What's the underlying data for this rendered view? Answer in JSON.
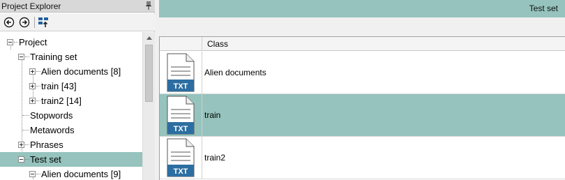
{
  "explorer": {
    "title": "Project Explorer",
    "toolbar": {
      "back_icon": "back-arrow-circle-icon",
      "forward_icon": "forward-arrow-circle-icon",
      "tool_icon": "tree-upload-icon"
    },
    "tree": [
      {
        "label": "Project",
        "expanded": true,
        "level": 0
      },
      {
        "label": "Training set",
        "expanded": true,
        "level": 1
      },
      {
        "label": "Alien documents [8]",
        "expanded": false,
        "level": 2
      },
      {
        "label": "train [43]",
        "expanded": false,
        "level": 2
      },
      {
        "label": "train2 [14]",
        "expanded": false,
        "level": 2
      },
      {
        "label": "Stopwords",
        "level": 1
      },
      {
        "label": "Metawords",
        "level": 1
      },
      {
        "label": "Phrases",
        "expanded": false,
        "level": 1
      },
      {
        "label": "Test set",
        "expanded": true,
        "level": 1,
        "selected": true
      },
      {
        "label": "Alien documents [9]",
        "expanded": true,
        "level": 2
      }
    ]
  },
  "document": {
    "title": "Test set",
    "column_header": "Class",
    "rows": [
      {
        "label": "Alien documents",
        "icon_text": "TXT",
        "selected": false
      },
      {
        "label": "train",
        "icon_text": "TXT",
        "selected": true
      },
      {
        "label": "train2",
        "icon_text": "TXT",
        "selected": false
      }
    ]
  },
  "colors": {
    "accent": "#96c3bd",
    "icon_blue": "#2c6ea1"
  }
}
